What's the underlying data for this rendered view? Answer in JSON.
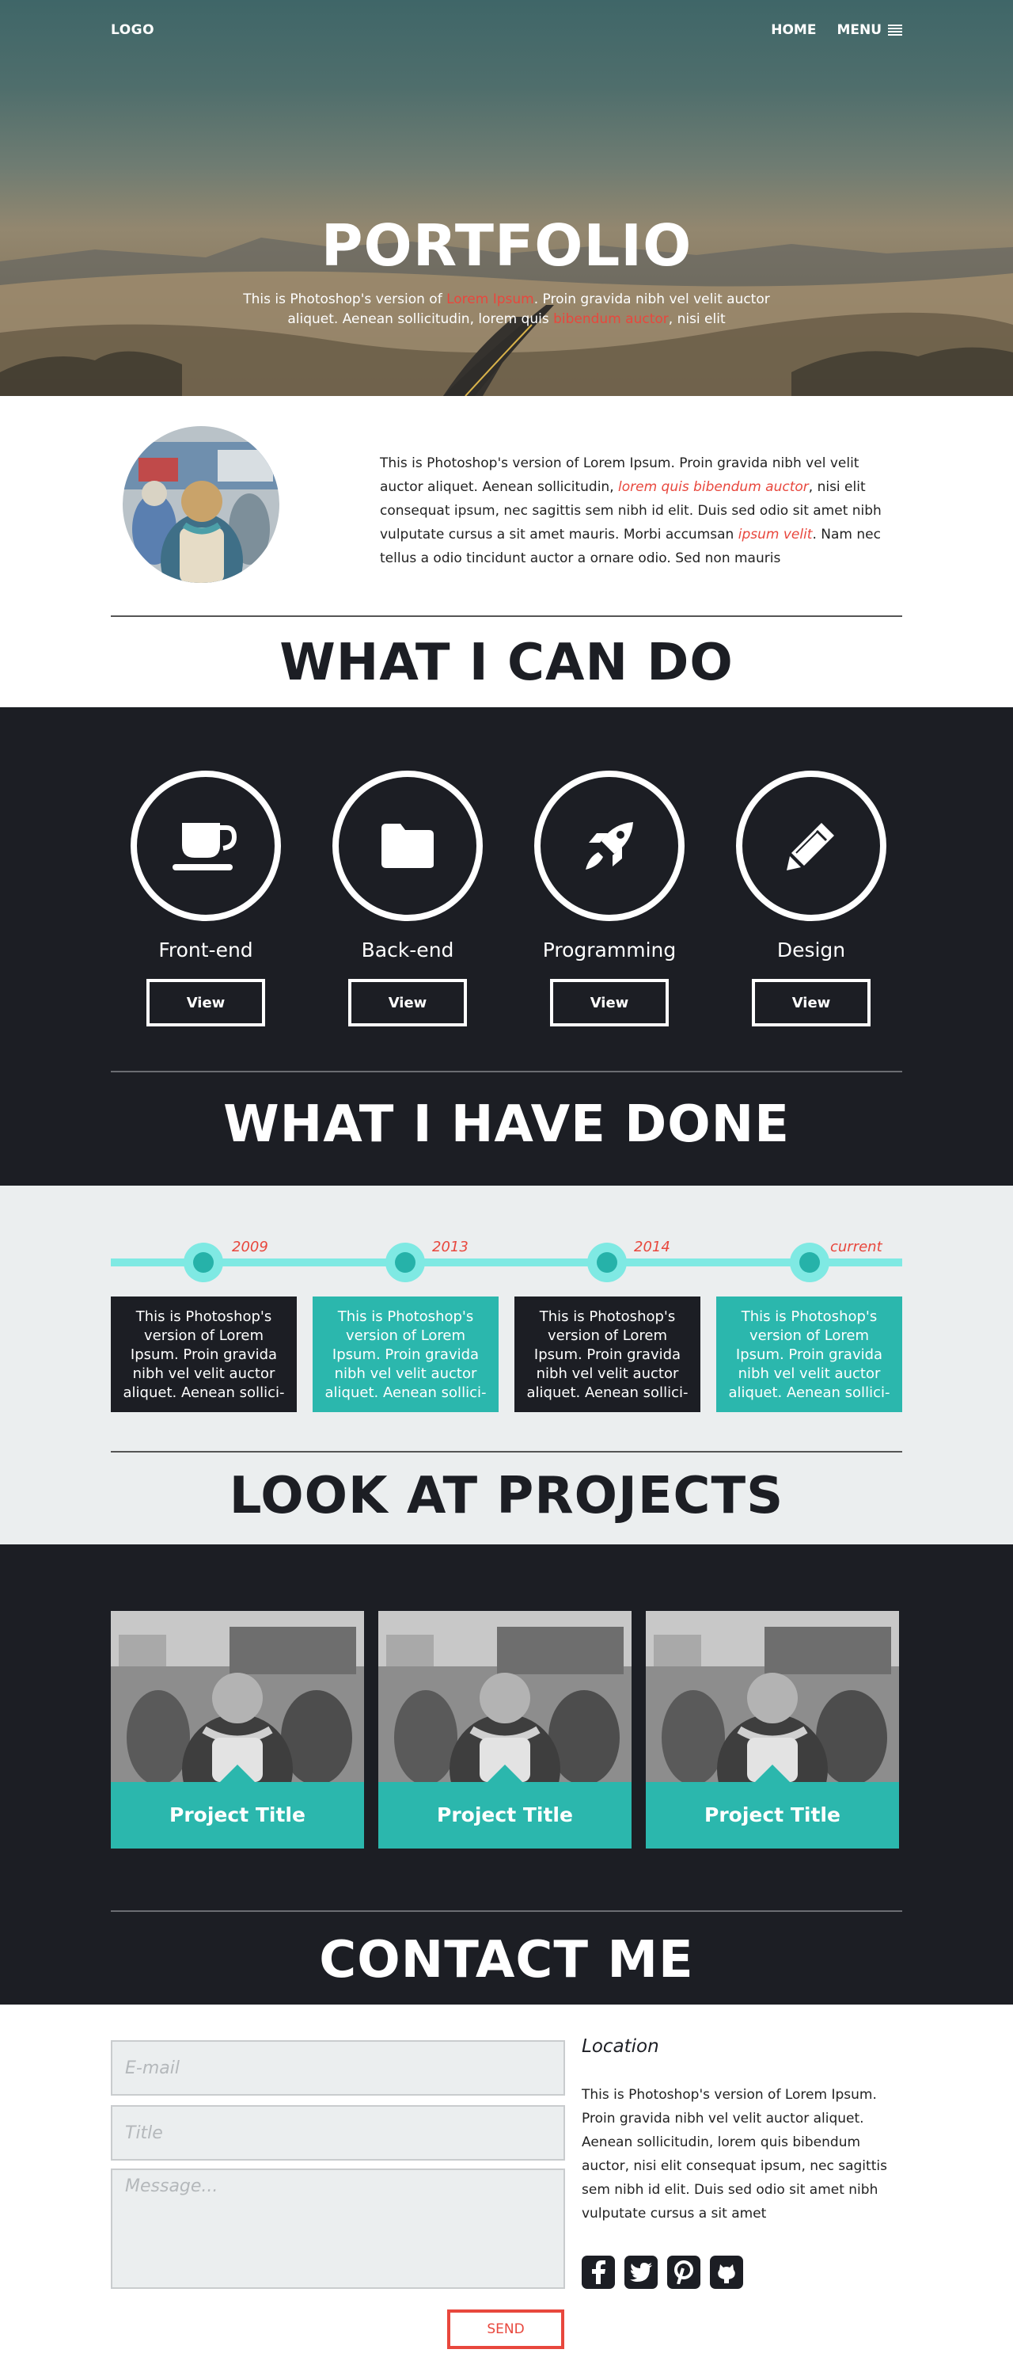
{
  "nav": {
    "logo": "LOGO",
    "home": "HOME",
    "menu": "MENU"
  },
  "hero": {
    "title": "PORTFOLIO",
    "sub_1": "This is Photoshop's version  of ",
    "sub_2": "Lorem Ipsum",
    "sub_3": ". Proin gravida nibh vel velit auctor aliquet. Aenean sollicitudin, lorem quis ",
    "sub_4": "bibendum auctor",
    "sub_5": ", nisi elit"
  },
  "about": {
    "t1": "This is Photoshop's version  of Lorem Ipsum. Proin gravida nibh vel velit auctor aliquet. Aenean sollicitudin, ",
    "t2": "lorem quis bibendum auctor",
    "t3": ", nisi elit consequat ipsum, nec sagittis sem nibh id elit. Duis sed odio sit amet nibh vulputate cursus a sit amet mauris. Morbi accumsan ",
    "t4": "ipsum velit",
    "t5": ". Nam nec tellus a odio tincidunt auctor a ornare odio. Sed non  mauris"
  },
  "sections": {
    "can_do": "WHAT I CAN DO",
    "have_done": "WHAT I HAVE DONE",
    "projects": "LOOK AT PROJECTS",
    "contact": "CONTACT ME"
  },
  "skills": [
    {
      "name": "Front-end",
      "icon": "coffee-cup-icon",
      "button": "View"
    },
    {
      "name": "Back-end",
      "icon": "folder-icon",
      "button": "View"
    },
    {
      "name": "Programming",
      "icon": "rocket-icon",
      "button": "View"
    },
    {
      "name": "Design",
      "icon": "pencil-icon",
      "button": "View"
    }
  ],
  "timeline": [
    {
      "year": "2009",
      "text": "This is Photoshop's version  of Lorem Ipsum. Proin gravida nibh vel velit auctor aliquet. Aenean sollici-"
    },
    {
      "year": "2013",
      "text": "This is Photoshop's version  of Lorem Ipsum. Proin gravida nibh vel velit auctor aliquet. Aenean sollici-"
    },
    {
      "year": "2014",
      "text": "This is Photoshop's version  of Lorem Ipsum. Proin gravida nibh vel velit auctor aliquet. Aenean sollici-"
    },
    {
      "year": "current",
      "text": "This is Photoshop's version  of Lorem Ipsum. Proin gravida nibh vel velit auctor aliquet. Aenean sollici-"
    }
  ],
  "projects": [
    {
      "title": "Project Title"
    },
    {
      "title": "Project Title"
    },
    {
      "title": "Project Title"
    }
  ],
  "contact": {
    "email_placeholder": "E-mail",
    "title_placeholder": "Title",
    "message_placeholder": "Message...",
    "location_title": "Location",
    "location_text": "This is Photoshop's version  of Lorem Ipsum. Proin gravida nibh vel velit auctor aliquet. Aenean sollicitudin, lorem quis bibendum auctor, nisi elit consequat ipsum, nec sagittis sem nibh id elit. Duis sed odio sit amet nibh vulputate cursus a sit amet",
    "send": "SEND",
    "socials": [
      "facebook-icon",
      "twitter-icon",
      "pinterest-icon",
      "github-icon"
    ]
  },
  "colors": {
    "dark": "#1c1e24",
    "teal": "#2bb7ad",
    "aqua": "#7fe9e3",
    "accent_red": "#e8473d",
    "light_gray": "#ebeeef"
  }
}
